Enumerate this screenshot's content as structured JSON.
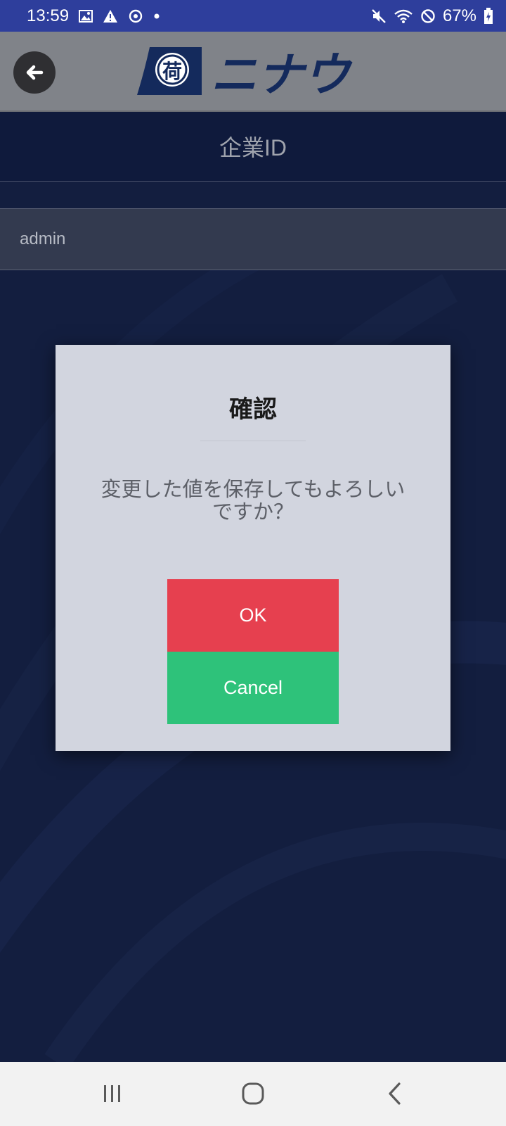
{
  "status_bar": {
    "time": "13:59",
    "battery": "67%",
    "icons_left": [
      "gallery-icon",
      "warning-icon",
      "sync-icon",
      "dot-icon"
    ],
    "icons_right": [
      "mute-icon",
      "wifi-icon",
      "dnd-icon",
      "battery-charging-icon"
    ]
  },
  "header": {
    "logo_kanji": "荷",
    "logo_text": "ニナウ"
  },
  "page": {
    "title": "企業ID",
    "field_value": "admin"
  },
  "dialog": {
    "title": "確認",
    "message": "変更した値を保存してもよろしいですか？",
    "ok_label": "OK",
    "cancel_label": "Cancel"
  },
  "colors": {
    "status_bar": "#2e3e9c",
    "header": "#808389",
    "ok": "#e6404f",
    "cancel": "#2ec27a",
    "dialog_bg": "#d2d5df",
    "logo_navy": "#142a5c"
  }
}
